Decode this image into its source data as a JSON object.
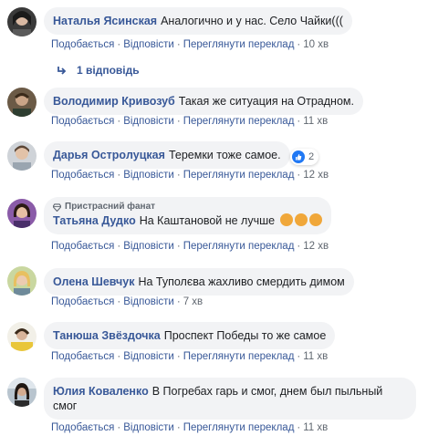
{
  "comments": [
    {
      "author": "Наталья Ясинская",
      "text": "Аналогично и у нас. Село Чайки(((",
      "like_label": "Подобається",
      "reply_label": "Відповісти",
      "translate_label": "Переглянути переклад",
      "time": "10 хв",
      "replies_label": "1 відповідь"
    },
    {
      "author": "Володимир Кривозуб",
      "text": "Такая же ситуация на Отрадном.",
      "like_label": "Подобається",
      "reply_label": "Відповісти",
      "translate_label": "Переглянути переклад",
      "time": "11 хв"
    },
    {
      "author": "Дарья Острoлуцкая",
      "text": "Теремки тоже самое.",
      "like_label": "Подобається",
      "reply_label": "Відповісти",
      "translate_label": "Переглянути переклад",
      "time": "12 хв",
      "reaction_count": "2"
    },
    {
      "badge": "Пристрасний фанат",
      "author": "Татьяна Дудко",
      "text": "На Каштановой не лучше",
      "like_label": "Подобається",
      "reply_label": "Відповісти",
      "translate_label": "Переглянути переклад",
      "time": "12 хв"
    },
    {
      "author": "Олена Шевчук",
      "text": "На Туполєва жахливо смердить димом",
      "like_label": "Подобається",
      "reply_label": "Відповісти",
      "time": "7 хв"
    },
    {
      "author": "Танюша Звёздочка",
      "text": "Проспект Победы то же самое",
      "like_label": "Подобається",
      "reply_label": "Відповісти",
      "translate_label": "Переглянути переклад",
      "time": "11 хв"
    },
    {
      "author": "Юлия Коваленко",
      "text_line1": "В Погребах гарь и смог, днем был пыльный",
      "text_line2": "смог",
      "like_label": "Подобається",
      "reply_label": "Відповісти",
      "translate_label": "Переглянути переклад",
      "time": "11 хв"
    }
  ],
  "colors": {
    "link": "#385898",
    "bubble": "#f2f3f5",
    "meta": "#606770",
    "like_blue": "#2078f4"
  }
}
